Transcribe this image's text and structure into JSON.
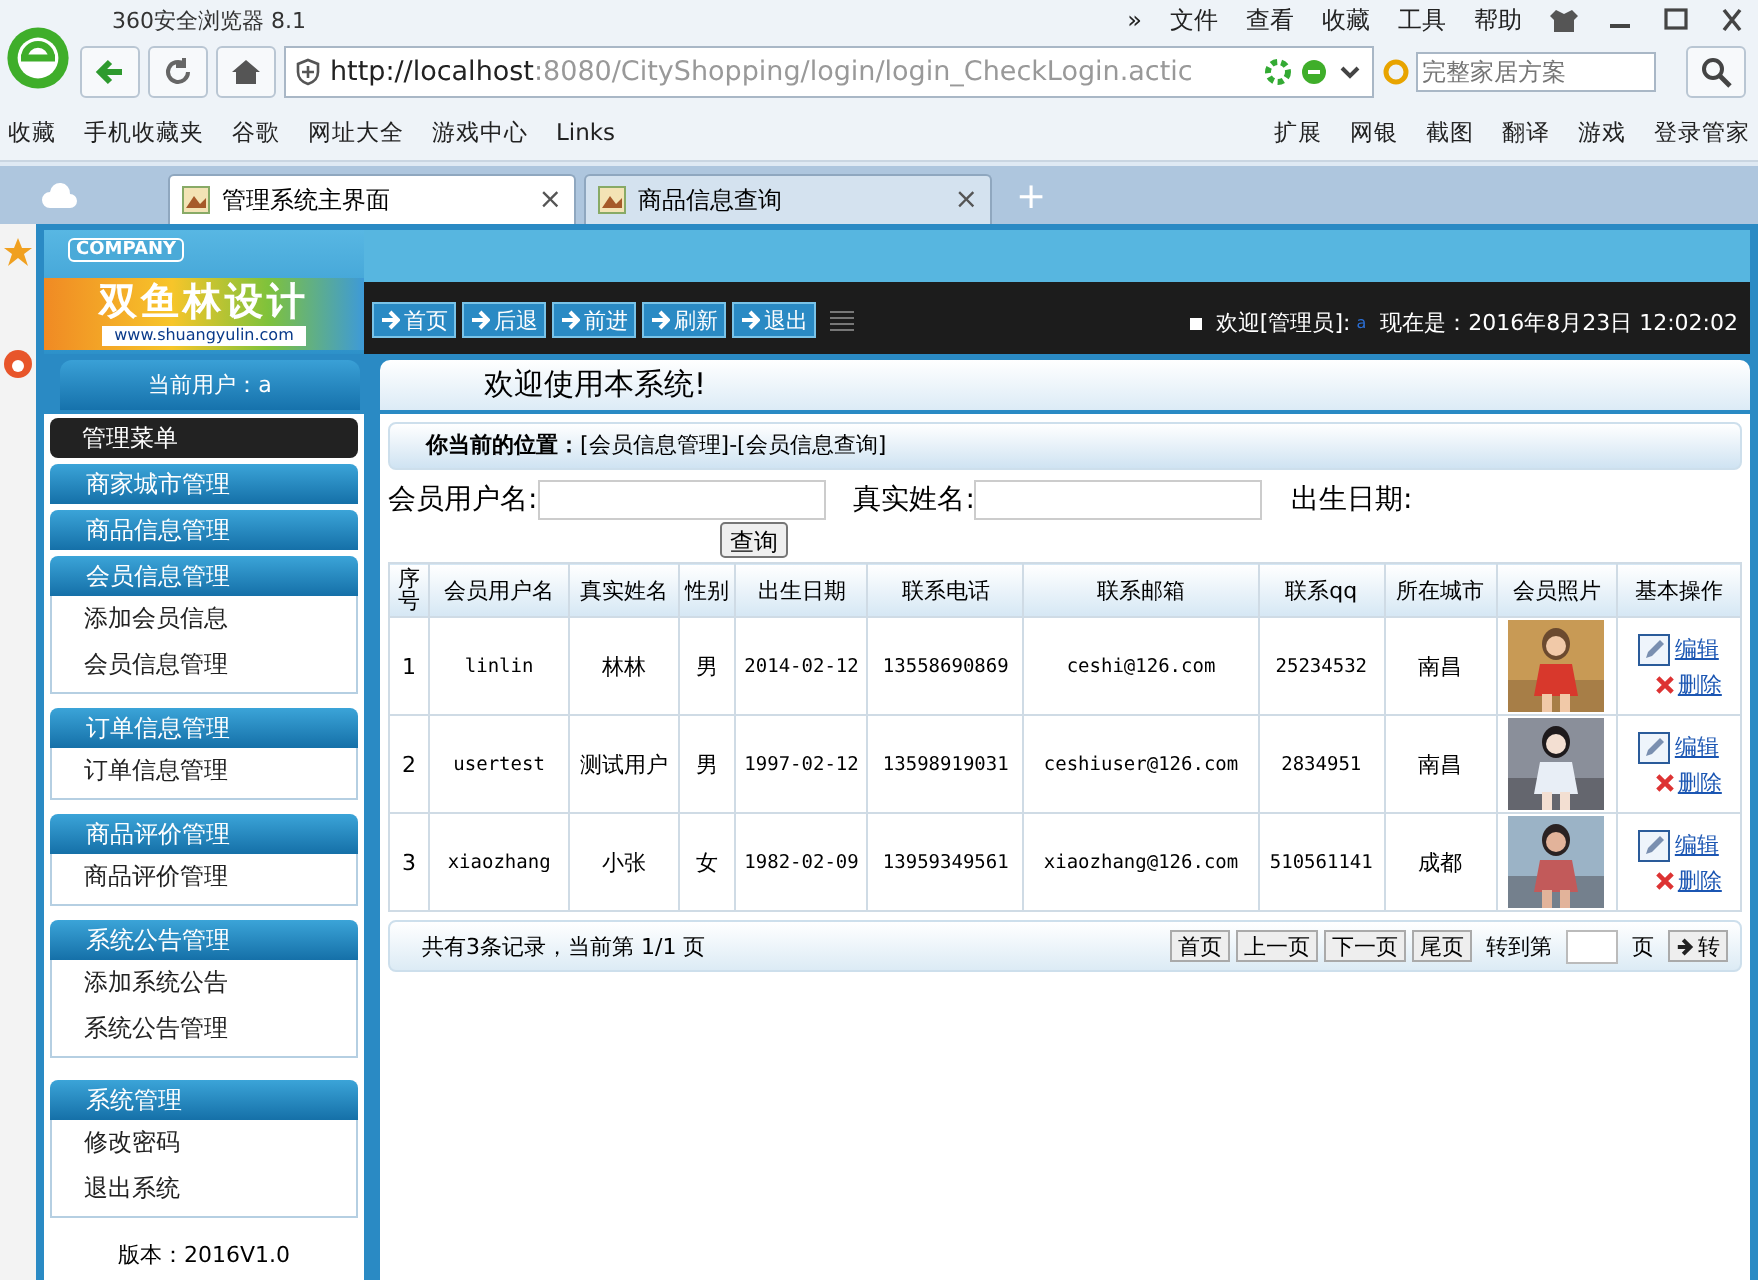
{
  "browser": {
    "title": "360安全浏览器 8.1",
    "menu": [
      "»",
      "文件",
      "查看",
      "收藏",
      "工具",
      "帮助"
    ],
    "url_host": "http://localhost",
    "url_rest": ":8080/CityShopping/login/login_CheckLogin.actic",
    "search_placeholder": "完整家居方案",
    "bookmarks": [
      "收藏",
      "手机收藏夹",
      "谷歌",
      "网址大全",
      "游戏中心",
      "Links"
    ],
    "bookmarks_right": [
      "扩展",
      "网银",
      "截图",
      "翻译",
      "游戏",
      "登录管家"
    ],
    "tabs": [
      {
        "label": "管理系统主界面",
        "close": "×",
        "selected": true
      },
      {
        "label": "商品信息查询",
        "close": "×",
        "selected": false
      }
    ],
    "new_tab": "+"
  },
  "header": {
    "company": "COMPANY",
    "logo": "双鱼林设计",
    "logo_url": "www.shuangyulin.com",
    "nav": [
      "首页",
      "后退",
      "前进",
      "刷新",
      "退出"
    ],
    "welcome": "欢迎[管理员]:",
    "user": "a",
    "time": "现在是：2016年8月23日 12:02:02"
  },
  "current_user": "当前用户：a",
  "welcome_message": "欢迎使用本系统!",
  "sidebar": {
    "title": "管理菜单",
    "groups": [
      {
        "label": "商家城市管理"
      },
      {
        "label": "商品信息管理"
      },
      {
        "label": "会员信息管理",
        "children": [
          "添加会员信息",
          "会员信息管理"
        ]
      },
      {
        "label": "订单信息管理",
        "children": [
          "订单信息管理"
        ]
      },
      {
        "label": "商品评价管理",
        "children": [
          "商品评价管理"
        ]
      },
      {
        "label": "系统公告管理",
        "children": [
          "添加系统公告",
          "系统公告管理"
        ]
      }
    ],
    "system": {
      "label": "系统管理",
      "items": [
        "修改密码",
        "退出系统"
      ]
    },
    "version": "版本：2016V1.0"
  },
  "breadcrumb": "**你当前的位置：**[会员信息管理]-[会员信息查询]",
  "search": {
    "fields": [
      "会员用户名:",
      "真实姓名:"
    ],
    "date_label": "出生日期:",
    "button": "查询"
  },
  "table": {
    "columns": [
      "序号",
      "会员用户名",
      "真实姓名",
      "性别",
      "出生日期",
      "联系电话",
      "联系邮箱",
      "联系qq",
      "所在城市",
      "会员照片",
      "基本操作"
    ],
    "rows": [
      {
        "cells": [
          "1",
          "linlin",
          "林林",
          "男",
          "2014-02-12",
          "13558690869",
          "ceshi@126.com",
          "25234532",
          "南昌"
        ],
        "edit": "编辑",
        "delete": "删除"
      },
      {
        "cells": [
          "2",
          "usertest",
          "测试用户",
          "男",
          "1997-02-12",
          "13598919031",
          "ceshiuser@126.com",
          "2834951",
          "南昌"
        ],
        "edit": "编辑",
        "delete": "删除"
      },
      {
        "cells": [
          "3",
          "xiaozhang",
          "小张",
          "女",
          "1982-02-09",
          "13959349561",
          "xiaozhang@126.com",
          "510561141",
          "成都"
        ],
        "edit": "编辑",
        "delete": "删除"
      }
    ]
  },
  "pagination": {
    "summary": "共有3条记录，当前第 1/1 页",
    "buttons": [
      "首页",
      "上一页",
      "下一页",
      "尾页"
    ],
    "goto_label": "转到第",
    "page_label": "页",
    "go_button": "转"
  }
}
